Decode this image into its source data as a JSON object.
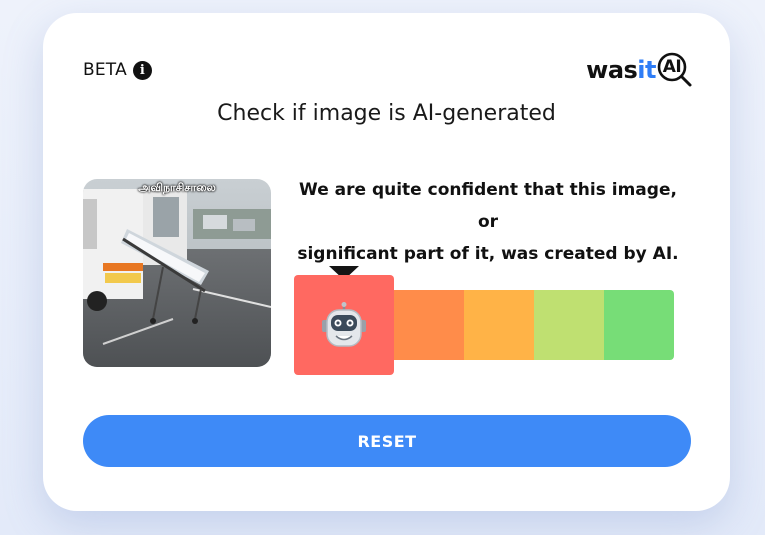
{
  "header": {
    "beta_label": "BETA",
    "info_icon": "info-circle-icon",
    "logo": {
      "part1": "was",
      "part2": "it",
      "badge_text": "AI"
    }
  },
  "main": {
    "heading": "Check if image is AI-generated",
    "image_caption": "அவிநாசிசாலை",
    "verdict_line1": "We are quite confident that this image, or",
    "verdict_line2": "significant part of it, was created by AI.",
    "meter": {
      "segments": [
        "#ff6961",
        "#ff8c4a",
        "#ffb347",
        "#bfe071",
        "#77dd77"
      ],
      "selected_index": 0,
      "selected_icon": "robot-face-icon"
    },
    "reset_label": "RESET"
  },
  "colors": {
    "accent": "#3e8af7",
    "logo_blue": "#2f7df6"
  }
}
